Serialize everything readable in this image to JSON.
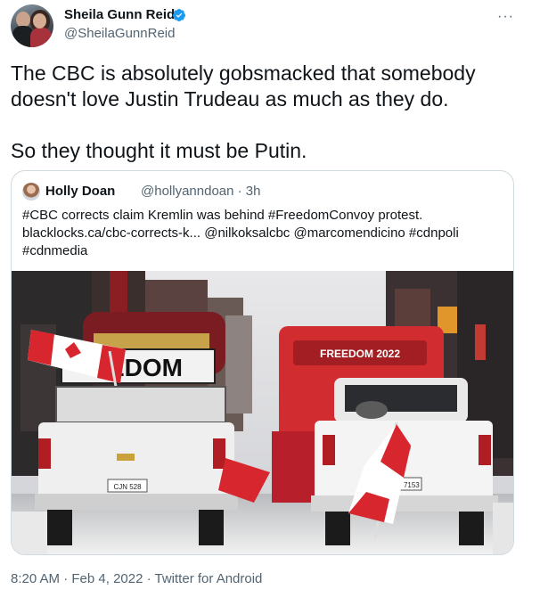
{
  "author": {
    "display_name": "Sheila Gunn Reid",
    "handle": "@SheilaGunnReid",
    "verified": true
  },
  "more_menu": "···",
  "tweet": {
    "lines": [
      "The CBC is absolutely gobsmacked that somebody",
      "doesn't love Justin Trudeau as much as they do.",
      "So they thought it must be Putin."
    ]
  },
  "quoted": {
    "display_name": "Holly Doan",
    "handle_time": "@hollyanndoan · 3h",
    "lines": [
      "#CBC corrects claim Kremlin was behind #FreedomConvoy protest.",
      "blacklocks.ca/cbc-corrects-k... @nilkoksalcbc @marcomendicino #cdnpoli",
      "#cdnmedia"
    ],
    "image": {
      "truck_sign_left": "EDOM",
      "truck_sign_right": "FREEDOM  2022",
      "plate_left": "CJN 528",
      "plate_right": "AT 7153"
    }
  },
  "footer": {
    "time": "8:20 AM",
    "date": "Feb 4, 2022",
    "source": "Twitter for Android",
    "separator": " · "
  },
  "colors": {
    "text": "#0f1419",
    "secondary": "#536471",
    "verified_blue": "#1d9bf0",
    "border": "#cfd9de"
  }
}
